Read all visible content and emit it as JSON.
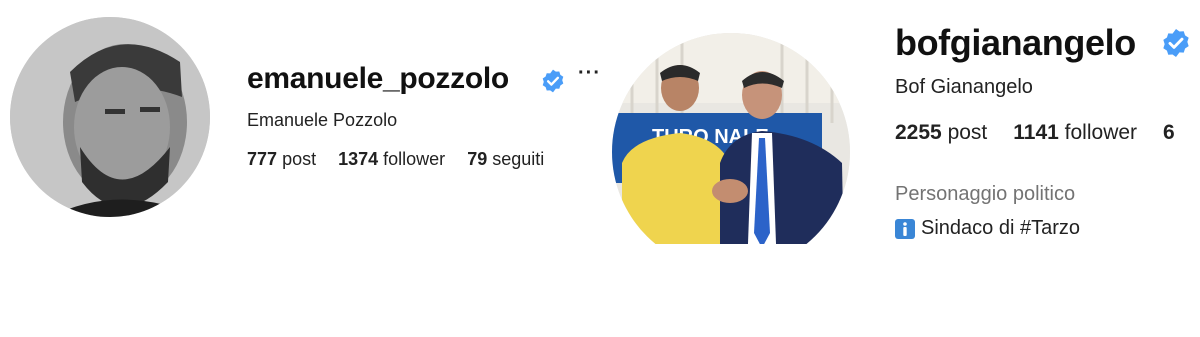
{
  "profile_left": {
    "username": "emanuele_pozzolo",
    "full_name": "Emanuele Pozzolo",
    "more_label": "···",
    "stats": [
      {
        "value": "777",
        "label": "post"
      },
      {
        "value": "1374",
        "label": "follower"
      },
      {
        "value": "79",
        "label": "seguiti"
      }
    ],
    "verified_icon": "verified-badge-icon",
    "colors": {
      "verified": "#4a9df8"
    }
  },
  "profile_right": {
    "username": "bofgianangelo",
    "full_name": "Bof Gianangelo",
    "stats": [
      {
        "value": "2255",
        "label": "post"
      },
      {
        "value": "1141",
        "label": "follower"
      },
      {
        "value": "6",
        "label": ""
      }
    ],
    "category": "Personaggio politico",
    "bio": "Sindaco di #Tarzo",
    "bio_icon": "information-icon",
    "verified_icon": "verified-badge-icon",
    "photo_banner_text": "TURO  NALE",
    "colors": {
      "verified": "#4a9df8",
      "category": "#737373"
    }
  }
}
